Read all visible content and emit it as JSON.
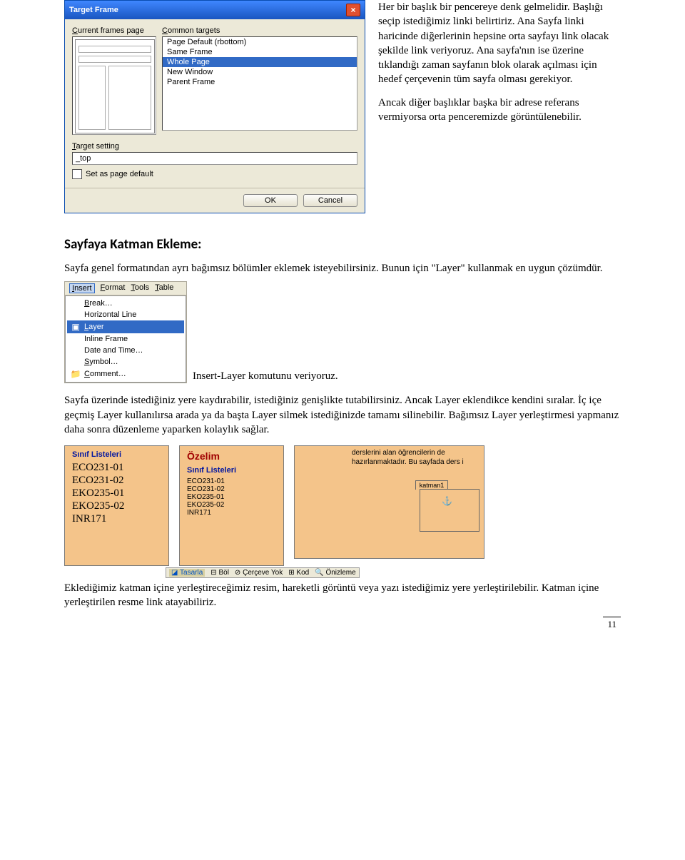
{
  "dialog": {
    "title": "Target Frame",
    "left_label": "Current frames page",
    "right_label": "Common targets",
    "targets": [
      "Page Default (rbottom)",
      "Same Frame",
      "Whole Page",
      "New Window",
      "Parent Frame"
    ],
    "target_setting_label": "Target setting",
    "target_setting_value": "_top",
    "set_default_label": "Set as page default",
    "ok": "OK",
    "cancel": "Cancel"
  },
  "side": {
    "p1": "Her bir başlık bir pencereye denk gelmelidir. Başlığı seçip istediğimiz linki belirtiriz. Ana Sayfa linki haricinde diğerlerinin hepsine orta sayfayı link olacak şekilde link veriyoruz. Ana sayfa'nın ise üzerine tıklandığı zaman sayfanın blok olarak açılması için hedef çerçevenin tüm sayfa olması gerekiyor.",
    "p2": "Ancak diğer başlıklar başka bir adrese referans vermiyorsa orta penceremizde görüntülenebilir."
  },
  "section_title": "Sayfaya Katman Ekleme:",
  "para1": "Sayfa genel formatından ayrı bağımsız bölümler eklemek isteyebilirsiniz. Bunun için \"Layer\" kullanmak en uygun çözümdür.",
  "menubar": {
    "insert": "Insert",
    "format": "Format",
    "tools": "Tools",
    "table": "Table"
  },
  "menu": {
    "break": "Break…",
    "hr": "Horizontal Line",
    "layer": "Layer",
    "iframe": "Inline Frame",
    "date": "Date and Time…",
    "symbol": "Symbol…",
    "comment": "Comment…"
  },
  "menu_caption": "Insert-Layer komutunu veriyoruz.",
  "para2": "Sayfa üzerinde istediğiniz yere kaydırabilir, istediğiniz genişlikte tutabilirsiniz. Ancak Layer eklendikce kendini sıralar. İç içe geçmiş Layer kullanılırsa arada ya da başta Layer silmek istediğinizde tamamı silinebilir. Bağımsız Layer yerleştirmesi yapmanız daha sonra düzenleme yaparken kolaylık sağlar.",
  "lp1": {
    "title": "Sınıf Listeleri",
    "items": [
      "ECO231-01",
      "ECO231-02",
      "EKO235-01",
      "EKO235-02",
      "INR171"
    ]
  },
  "lp2": {
    "title": "Özelim",
    "subtitle": "Sınıf Listeleri",
    "items": [
      "ECO231-01",
      "ECO231-02",
      "EKO235-01",
      "EKO235-02",
      "INR171"
    ]
  },
  "lp3": {
    "desc": "derslerini alan öğrencilerin de hazırlanmaktadır. Bu sayfada ders i",
    "katman_label": "katman1"
  },
  "strip": {
    "design": "Tasarla",
    "split": "Böl",
    "noframe": "Çerçeve Yok",
    "code": "Kod",
    "preview": "Önizleme"
  },
  "para3": "Eklediğimiz katman içine yerleştireceğimiz resim, hareketli görüntü veya yazı istediğimiz yere yerleştirilebilir. Katman içine yerleştirilen resme link atayabiliriz.",
  "page_number": "11"
}
